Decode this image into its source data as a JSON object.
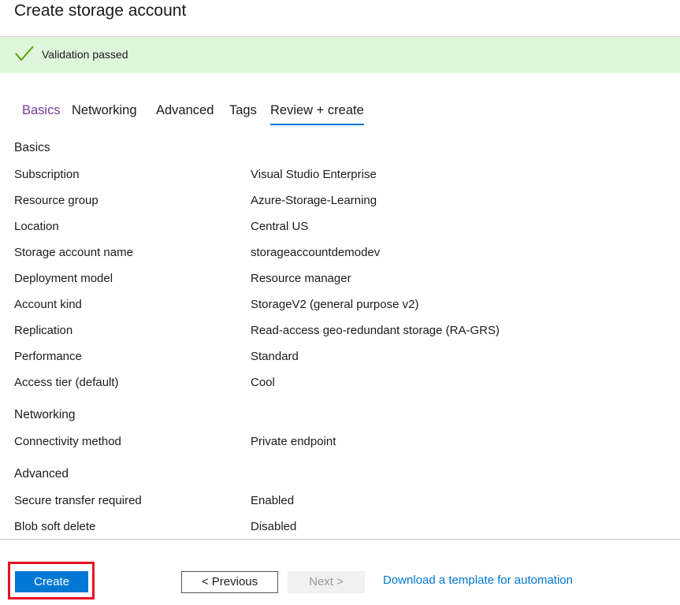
{
  "page": {
    "title": "Create storage account"
  },
  "banner": {
    "message": "Validation passed",
    "icon": "checkmark-icon",
    "color": "#57a300",
    "background": "#dff6dd"
  },
  "tabs": [
    {
      "label": "Basics",
      "state": "visited"
    },
    {
      "label": "Networking",
      "state": "default"
    },
    {
      "label": "Advanced",
      "state": "default"
    },
    {
      "label": "Tags",
      "state": "default"
    },
    {
      "label": "Review + create",
      "state": "active"
    }
  ],
  "review": {
    "basics": {
      "heading": "Basics",
      "rows": [
        {
          "label": "Subscription",
          "value": "Visual Studio Enterprise"
        },
        {
          "label": "Resource group",
          "value": "Azure-Storage-Learning"
        },
        {
          "label": "Location",
          "value": "Central US"
        },
        {
          "label": "Storage account name",
          "value": "storageaccountdemodev"
        },
        {
          "label": "Deployment model",
          "value": "Resource manager"
        },
        {
          "label": "Account kind",
          "value": "StorageV2 (general purpose v2)"
        },
        {
          "label": "Replication",
          "value": "Read-access geo-redundant storage (RA-GRS)"
        },
        {
          "label": "Performance",
          "value": "Standard"
        },
        {
          "label": "Access tier (default)",
          "value": "Cool"
        }
      ]
    },
    "networking": {
      "heading": "Networking",
      "rows": [
        {
          "label": "Connectivity method",
          "value": "Private endpoint"
        }
      ]
    },
    "advanced": {
      "heading": "Advanced",
      "rows": [
        {
          "label": "Secure transfer required",
          "value": "Enabled"
        },
        {
          "label": "Blob soft delete",
          "value": "Disabled"
        }
      ]
    }
  },
  "footer": {
    "create_label": "Create",
    "previous_label": "< Previous",
    "next_label": "Next >",
    "template_link": "Download a template for automation"
  },
  "colors": {
    "accent": "#0078d4",
    "visited_tab": "#773b9f",
    "highlight": "#e81123"
  }
}
